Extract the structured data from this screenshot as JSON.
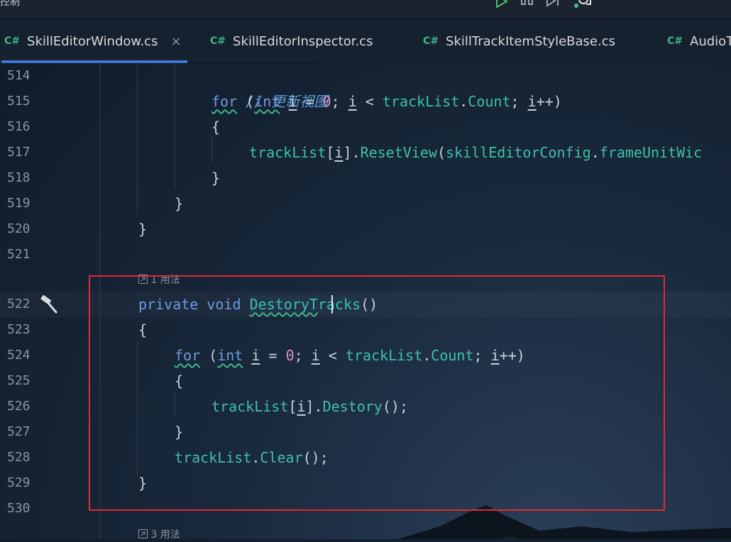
{
  "window": {
    "title_fragment": "控制"
  },
  "tabs": [
    {
      "lang": "C#",
      "label": "SkillEditorWindow.cs",
      "active": true,
      "close": "×"
    },
    {
      "lang": "C#",
      "label": "SkillEditorInspector.cs",
      "active": false
    },
    {
      "lang": "C#",
      "label": "SkillTrackItemStyleBase.cs",
      "active": false
    },
    {
      "lang": "C#",
      "label": "AudioT",
      "active": false
    }
  ],
  "editor": {
    "line_numbers": [
      "514",
      "515",
      "516",
      "517",
      "518",
      "519",
      "520",
      "521",
      "522",
      "523",
      "524",
      "525",
      "526",
      "527",
      "528",
      "529",
      "530"
    ],
    "hints": {
      "usage_1": "1 用法",
      "usage_3": "3 用法"
    },
    "code": {
      "l514_comment": "// 更新视图",
      "l515_for": "for",
      "l515_paren_open": " (",
      "l515_int": "int",
      "l515_i1": "i",
      "l515_eq": " = ",
      "l515_zero": "0",
      "l515_semi1": "; ",
      "l515_i2": "i",
      "l515_lt": " < ",
      "l515_list": "trackList",
      "l515_dot": ".",
      "l515_count": "Count",
      "l515_semi2": "; ",
      "l515_i3": "i",
      "l515_inc": "++)",
      "l516": "{",
      "l517_list": "trackList",
      "l517_bracket_open": "[",
      "l517_i": "i",
      "l517_bracket_close": "].",
      "l517_fn": "ResetView",
      "l517_paren": "(",
      "l517_cfg": "skillEditorConfig",
      "l517_dot": ".",
      "l517_field": "frameUnitWic",
      "l518": "}",
      "l519": "}",
      "l520": "}",
      "l522_private": "private",
      "l522_void": "void",
      "l522_name_a": "DestoryT",
      "l522_name_b": "racks",
      "l522_paren": "()",
      "l523": "{",
      "l524_for": "for",
      "l524_paren_open": " (",
      "l524_int": "int",
      "l524_i1": "i",
      "l524_eq": " = ",
      "l524_zero": "0",
      "l524_semi1": "; ",
      "l524_i2": "i",
      "l524_lt": " < ",
      "l524_list": "trackList",
      "l524_dot": ".",
      "l524_count": "Count",
      "l524_semi2": "; ",
      "l524_i3": "i",
      "l524_inc": "++)",
      "l525": "{",
      "l526_list": "trackList",
      "l526_bracket_open": "[",
      "l526_i": "i",
      "l526_bracket_close": "].",
      "l526_fn": "Destory",
      "l526_tail": "();",
      "l527": "}",
      "l528_list": "trackList",
      "l528_dot": ".",
      "l528_fn": "Clear",
      "l528_tail": "();",
      "l529": "}"
    }
  },
  "icons": {
    "gutter": "hammer-icon",
    "hint": "usage-link-icon"
  },
  "colors": {
    "selection_box": "#e02a2f",
    "active_tab_underline": "#3c74d6",
    "keyword": "#6f9be0",
    "function": "#3fc0a8",
    "number": "#d98fc0"
  }
}
